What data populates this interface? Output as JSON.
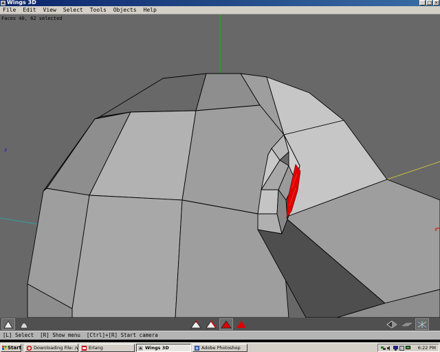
{
  "window": {
    "title": "Wings 3D",
    "controls": [
      "_",
      "□",
      "×"
    ]
  },
  "menu": [
    "File",
    "Edit",
    "View",
    "Select",
    "Tools",
    "Objects",
    "Help"
  ],
  "viewport": {
    "info_text": "Faces 40, 62 selected",
    "axis_labels": {
      "z": "z",
      "x": "x"
    },
    "colors": {
      "background": "#686868",
      "selection": "#e00000",
      "y_axis": "#00c000",
      "z_axis": "#0000e0",
      "x_axis": "#e00000"
    }
  },
  "toolbar": {
    "view_buttons": [
      {
        "name": "smooth-shading-icon"
      },
      {
        "name": "smooth-preview-icon"
      }
    ],
    "select_modes": [
      {
        "name": "vertex-select-mode-icon",
        "active": false
      },
      {
        "name": "edge-select-mode-icon",
        "active": false
      },
      {
        "name": "face-select-mode-icon",
        "active": true
      },
      {
        "name": "body-select-mode-icon",
        "active": false
      }
    ],
    "right_buttons": [
      {
        "name": "perspective-icon"
      },
      {
        "name": "ground-grid-icon"
      },
      {
        "name": "axes-icon"
      }
    ]
  },
  "status": {
    "text": "[L] Select  [R] Show menu  [Ctrl]+[R] Start camera"
  },
  "taskbar": {
    "start_label": "Start",
    "tasks": [
      {
        "label": "Downloading File: /wings/...",
        "active": false
      },
      {
        "label": "Erlang",
        "active": false
      },
      {
        "label": "Wings 3D",
        "active": true
      },
      {
        "label": "Adobe Photoshop",
        "active": false
      }
    ],
    "clock": "6:22 PM"
  }
}
